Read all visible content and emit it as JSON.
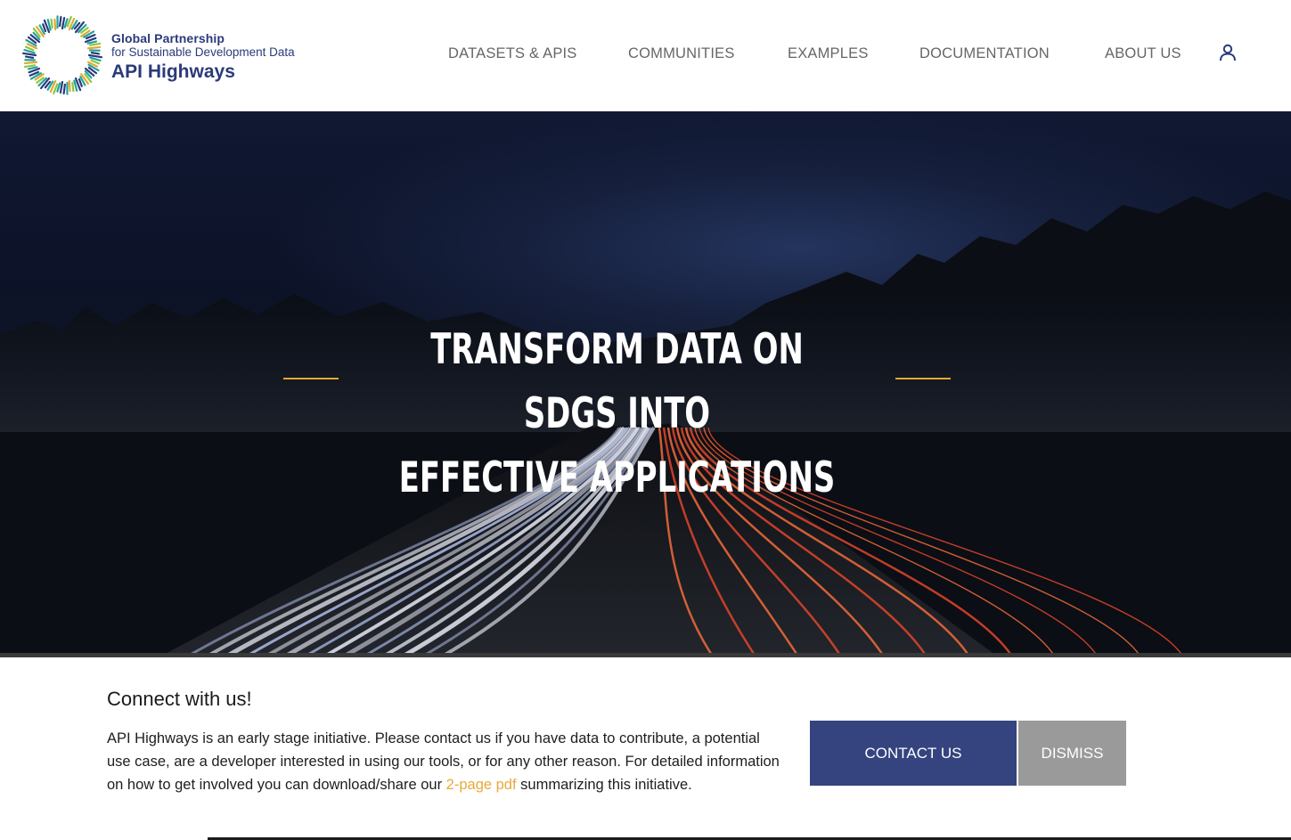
{
  "brand": {
    "line1": "Global Partnership",
    "line2": "for Sustainable Development Data",
    "line3": "API Highways",
    "colors": {
      "navy": "#2b3a7a",
      "accent": "#e3a830",
      "teal": "#1ea3a0",
      "green": "#8cc63f"
    }
  },
  "nav": {
    "items": [
      {
        "label": "DATASETS & APIS"
      },
      {
        "label": "COMMUNITIES"
      },
      {
        "label": "EXAMPLES"
      },
      {
        "label": "DOCUMENTATION"
      },
      {
        "label": "ABOUT US"
      }
    ],
    "user_icon": "user-icon"
  },
  "hero": {
    "title_line1": "TRANSFORM DATA ON SDGS INTO",
    "title_line2": "EFFECTIVE APPLICATIONS",
    "background": "night highway light trails"
  },
  "notice": {
    "title": "Connect with us!",
    "body_before_link": "API Highways is an early stage initiative. Please contact us if you have data to contribute, a potential use case, are a developer interested in using our tools, or for any other reason. For detailed information on how to get involved you can download/share our ",
    "link_text": "2-page pdf",
    "body_after_link": " summarizing this initiative.",
    "contact_button": "CONTACT US",
    "dismiss_button": "DISMISS",
    "colors": {
      "contact_bg": "#35437f",
      "dismiss_bg": "#9a9a9a",
      "link": "#e8a93a"
    }
  }
}
